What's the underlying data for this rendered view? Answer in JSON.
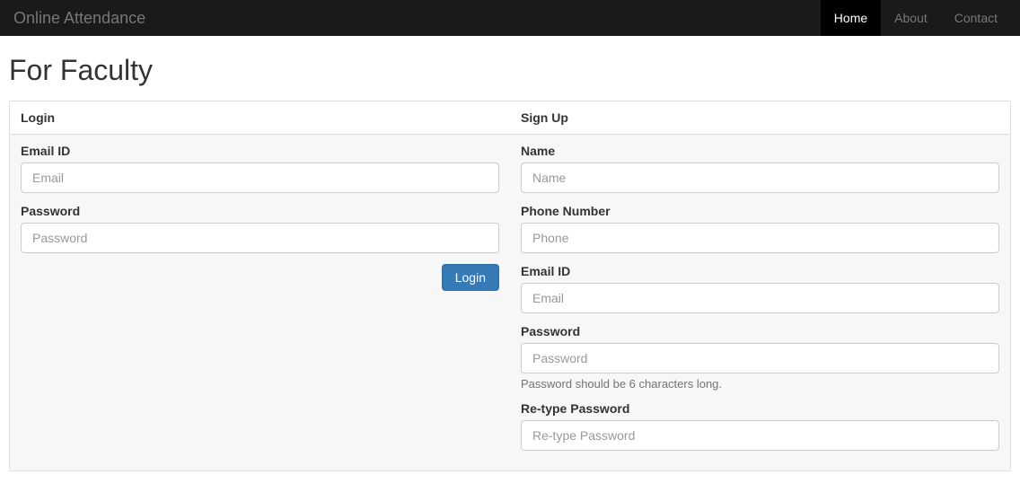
{
  "navbar": {
    "brand": "Online Attendance",
    "items": [
      {
        "label": "Home",
        "active": true
      },
      {
        "label": "About",
        "active": false
      },
      {
        "label": "Contact",
        "active": false
      }
    ]
  },
  "page": {
    "title": "For Faculty"
  },
  "login": {
    "heading": "Login",
    "email_label": "Email ID",
    "email_placeholder": "Email",
    "password_label": "Password",
    "password_placeholder": "Password",
    "submit_label": "Login"
  },
  "signup": {
    "heading": "Sign Up",
    "name_label": "Name",
    "name_placeholder": "Name",
    "phone_label": "Phone Number",
    "phone_placeholder": "Phone",
    "email_label": "Email ID",
    "email_placeholder": "Email",
    "password_label": "Password",
    "password_placeholder": "Password",
    "password_hint": "Password should be 6 characters long.",
    "retype_label": "Re-type Password",
    "retype_placeholder": "Re-type Password"
  }
}
